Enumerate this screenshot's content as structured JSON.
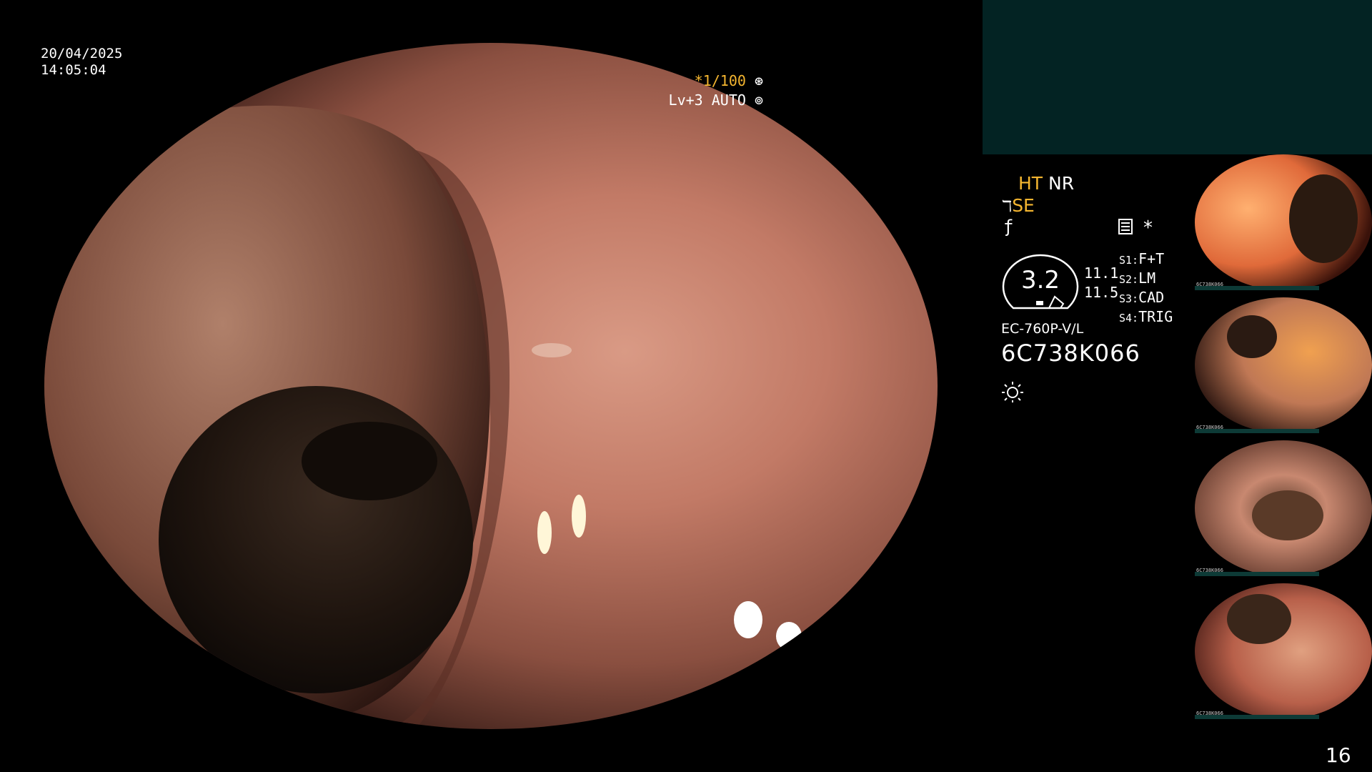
{
  "overlay": {
    "date": "20/04/2025",
    "time": "14:05:04",
    "zoom": "*1/100",
    "level": "Lv+3 AUTO"
  },
  "panel": {
    "ht": "HT",
    "nr": "NR",
    "se": "SE",
    "star": "*",
    "dial_value": "3.2",
    "num1": "11.1",
    "num2": "11.5",
    "switches": [
      {
        "key": "S1:",
        "value": "F+T"
      },
      {
        "key": "S2:",
        "value": "LM"
      },
      {
        "key": "S3:",
        "value": "CAD"
      },
      {
        "key": "S4:",
        "value": "TRIG"
      }
    ],
    "scope_model": "EC-760P-V/L",
    "serial": "6C738K066"
  },
  "thumbnails": [
    {
      "label": "6C738K066"
    },
    {
      "label": "6C738K066"
    },
    {
      "label": "6C738K066"
    },
    {
      "label": "6C738K066"
    }
  ],
  "page_number": "16",
  "colors": {
    "accent": "#f5b630",
    "panel_teal": "#032323"
  },
  "icons": [
    "shutter-icon",
    "auto-iris-icon",
    "scope-tip-icon",
    "f-symbol-icon",
    "memo-icon",
    "light-icon"
  ]
}
